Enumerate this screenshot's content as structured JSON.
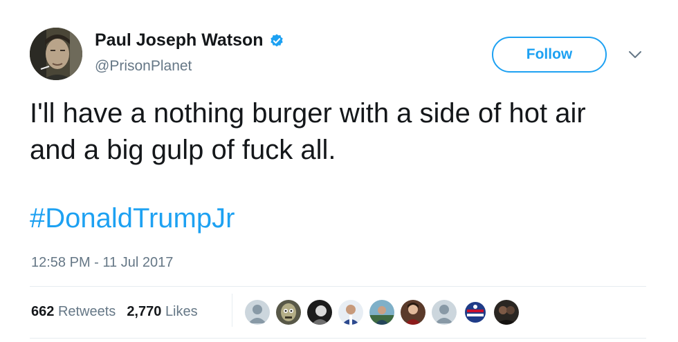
{
  "author": {
    "name": "Paul Joseph Watson",
    "handle": "@PrisonPlanet",
    "verified": true,
    "avatar_icon": "profile-photo-avatar"
  },
  "actions": {
    "follow_label": "Follow",
    "more_icon": "chevron-down-icon"
  },
  "tweet": {
    "text_lines": [
      "I'll have a nothing burger with a side of hot air",
      "and a big gulp of fuck all."
    ],
    "hashtag": "#DonaldTrumpJr",
    "timestamp": "12:58 PM - 11 Jul 2017"
  },
  "stats": {
    "retweets_count": "662",
    "retweets_label": "Retweets",
    "likes_count": "2,770",
    "likes_label": "Likes"
  },
  "likers": [
    "default-avatar",
    "photo-avatar",
    "photo-avatar",
    "photo-avatar",
    "photo-avatar",
    "photo-avatar",
    "default-avatar",
    "photo-avatar",
    "photo-avatar"
  ],
  "colors": {
    "accent": "#1da1f2",
    "secondary_text": "#657786",
    "primary_text": "#14171a",
    "divider": "#e6ecf0"
  }
}
